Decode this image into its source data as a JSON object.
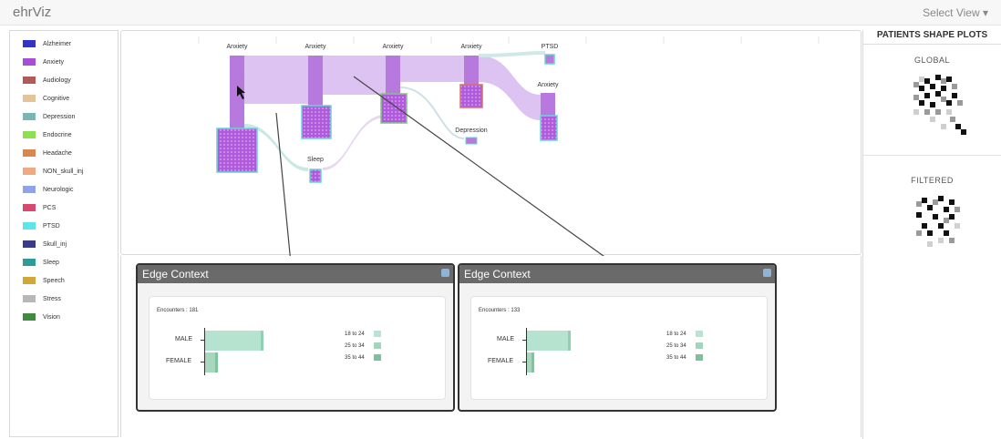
{
  "app": {
    "title": "ehrViz",
    "select_view": "Select View ▾"
  },
  "legend": {
    "items": [
      {
        "label": "Alzheimer",
        "color": "#3333cc"
      },
      {
        "label": "Anxiety",
        "color": "#a64fd6"
      },
      {
        "label": "Audiology",
        "color": "#b05a5a"
      },
      {
        "label": "Cognitive",
        "color": "#e6c49b"
      },
      {
        "label": "Depression",
        "color": "#79b6b3"
      },
      {
        "label": "Endocrine",
        "color": "#8fe04f"
      },
      {
        "label": "Headache",
        "color": "#d98850"
      },
      {
        "label": "NON_skull_inj",
        "color": "#efaa85"
      },
      {
        "label": "Neurologic",
        "color": "#8ea3e8"
      },
      {
        "label": "PCS",
        "color": "#d9486f"
      },
      {
        "label": "PTSD",
        "color": "#5ce6ea"
      },
      {
        "label": "Skull_inj",
        "color": "#3a3a8a"
      },
      {
        "label": "Sleep",
        "color": "#2e9a9a"
      },
      {
        "label": "Speech",
        "color": "#d0a838"
      },
      {
        "label": "Stress",
        "color": "#b8b8b8"
      },
      {
        "label": "Vision",
        "color": "#3f8a3f"
      }
    ]
  },
  "sankey": {
    "nodes": [
      {
        "label": "Anxiety"
      },
      {
        "label": "Anxiety"
      },
      {
        "label": "Anxiety"
      },
      {
        "label": "Anxiety"
      },
      {
        "label": "PTSD"
      },
      {
        "label": "Sleep"
      },
      {
        "label": "Depression"
      },
      {
        "label": "Anxiety"
      }
    ]
  },
  "edge_contexts": [
    {
      "title": "Edge Context",
      "encounters": "Encounters : 181",
      "male_label": "MALE",
      "female_label": "FEMALE",
      "ages": [
        "18 to 24",
        "25 to 34",
        "35 to 44"
      ]
    },
    {
      "title": "Edge Context",
      "encounters": "Encounters : 133",
      "male_label": "MALE",
      "female_label": "FEMALE",
      "ages": [
        "18 to 24",
        "25 to 34",
        "35 to 44"
      ]
    }
  ],
  "right_panel": {
    "title": "PATIENTS SHAPE PLOTS",
    "global_label": "GLOBAL",
    "filtered_label": "FILTERED"
  },
  "colors": {
    "flow": "#d7b8ef",
    "node": "#b577dd",
    "age_18_24": "#b9e4d0",
    "age_25_34": "#a2d5bb",
    "age_35_44": "#7fbf9c"
  }
}
